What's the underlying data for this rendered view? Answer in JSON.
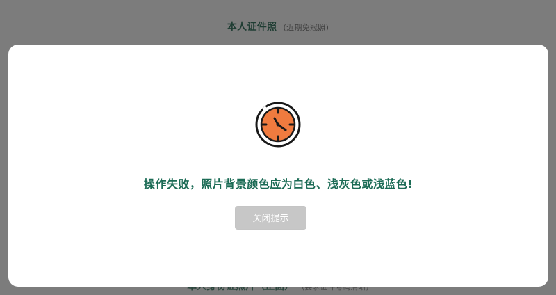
{
  "background": {
    "top_title": "本人证件照",
    "top_subtitle": "(近期免冠照)",
    "bottom_title": "本人身份证照片（正面）",
    "bottom_subtitle": "(要求证件号码清晰)"
  },
  "dialog": {
    "icon": "clock-icon",
    "message": "操作失败，照片背景颜色应为白色、浅灰色或浅蓝色!",
    "close_label": "关闭提示"
  },
  "colors": {
    "message": "#1b6b55",
    "icon_fill": "#f07b3f",
    "overlay": "#7c7c7c",
    "button_bg": "#c7c7c7"
  }
}
